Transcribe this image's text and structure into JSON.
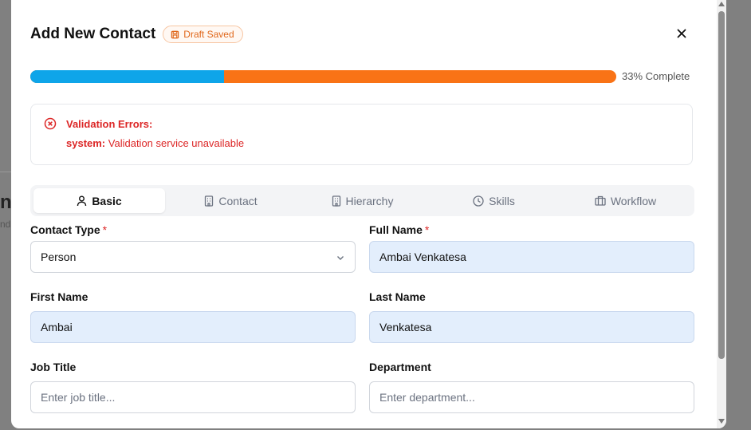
{
  "modal": {
    "title": "Add New Contact",
    "draft_badge": "Draft Saved",
    "progress_percent": 33,
    "progress_label": "33% Complete",
    "colors": {
      "progress_fill": "#0ea5e9",
      "progress_track": "#f97316",
      "error": "#dc2626",
      "draft": "#e0671b"
    }
  },
  "alert": {
    "title": "Validation Errors:",
    "key": "system:",
    "message": "Validation service unavailable",
    "icon": "x-circle-icon"
  },
  "tabs": [
    {
      "label": "Basic",
      "icon": "user-icon",
      "active": true
    },
    {
      "label": "Contact",
      "icon": "building-icon",
      "active": false
    },
    {
      "label": "Hierarchy",
      "icon": "building-icon",
      "active": false
    },
    {
      "label": "Skills",
      "icon": "clock-icon",
      "active": false
    },
    {
      "label": "Workflow",
      "icon": "briefcase-icon",
      "active": false
    }
  ],
  "form": {
    "contact_type": {
      "label": "Contact Type",
      "value": "Person",
      "required": "*"
    },
    "full_name": {
      "label": "Full Name",
      "value": "Ambai Venkatesa",
      "required": "*"
    },
    "first_name": {
      "label": "First Name",
      "value": "Ambai"
    },
    "last_name": {
      "label": "Last Name",
      "value": "Venkatesa"
    },
    "job_title": {
      "label": "Job Title",
      "placeholder": "Enter job title..."
    },
    "department": {
      "label": "Department",
      "placeholder": "Enter department..."
    }
  }
}
